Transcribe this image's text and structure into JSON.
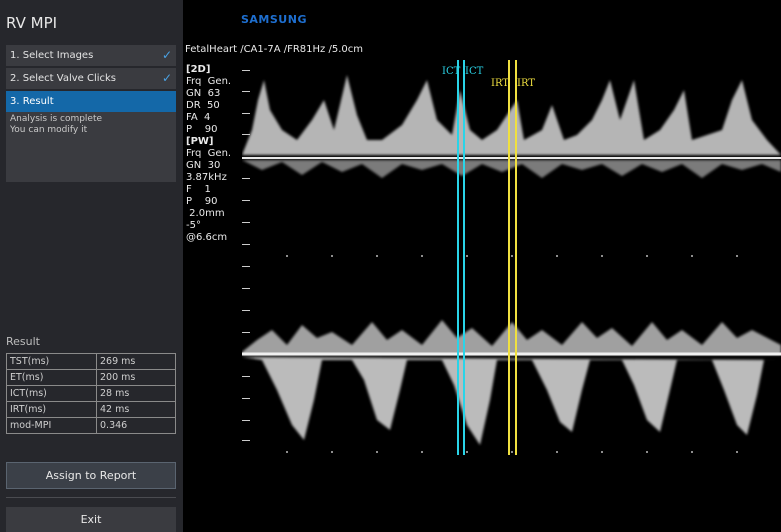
{
  "app": {
    "title": "RV MPI",
    "brand": "SAMSUNG"
  },
  "steps": [
    {
      "label": "1. Select Images",
      "done": true
    },
    {
      "label": "2. Select Valve Clicks",
      "done": true
    },
    {
      "label": "3. Result",
      "done": false
    }
  ],
  "status": {
    "line1": "Analysis is complete",
    "line2": "You can modify it"
  },
  "result": {
    "title": "Result",
    "rows": [
      {
        "name": "TST(ms)",
        "value": "269 ms"
      },
      {
        "name": "ET(ms)",
        "value": "200 ms"
      },
      {
        "name": "ICT(ms)",
        "value": "28 ms"
      },
      {
        "name": "IRT(ms)",
        "value": "42 ms"
      },
      {
        "name": "mod-MPI",
        "value": "0.346"
      }
    ]
  },
  "buttons": {
    "assign": "Assign to Report",
    "exit": "Exit"
  },
  "image_info": "FetalHeart /CA1-7A /FR81Hz /5.0cm",
  "params_2d": {
    "header": "[2D]",
    "lines": [
      "Frq  Gen.",
      "GN  63",
      "DR  50",
      "FA  4",
      "P    90"
    ]
  },
  "params_pw": {
    "header": "[PW]",
    "lines": [
      "Frq  Gen.",
      "GN  30",
      "3.87kHz",
      "F    1",
      "P    90",
      " 2.0mm",
      "-5°",
      "@6.6cm"
    ]
  },
  "markers": {
    "ict_label": "ICT",
    "irt_label": "IRT",
    "ict_color": "#2ad4e8",
    "irt_color": "#f0e040"
  }
}
